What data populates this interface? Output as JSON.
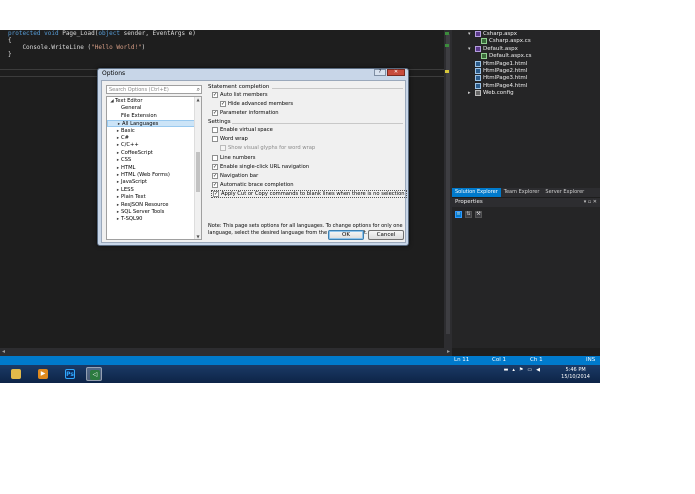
{
  "editor": {
    "lines": [
      {
        "kw1": "protected",
        "kw2": "void",
        "name": " Page_Load(",
        "kw3": "object",
        "rest": " sender, EventArgs e)"
      },
      {
        "text": "{"
      },
      {
        "pre": "    Console.WriteLine (",
        "str": "\"Hello World!\"",
        "post": ")"
      },
      {
        "text": "}"
      }
    ]
  },
  "solution_explorer": {
    "items": [
      {
        "label": "Csharp.aspx",
        "indent": 2,
        "expander": "▾",
        "icon": "aspx-file-icon"
      },
      {
        "label": "Csharp.aspx.cs",
        "indent": 3,
        "expander": "",
        "icon": "cs-file-icon"
      },
      {
        "label": "Default.aspx",
        "indent": 2,
        "expander": "▾",
        "icon": "aspx-file-icon"
      },
      {
        "label": "Default.aspx.cs",
        "indent": 3,
        "expander": "",
        "icon": "cs-file-icon"
      },
      {
        "label": "HtmlPage1.html",
        "indent": 2,
        "expander": "",
        "icon": "html-file-icon"
      },
      {
        "label": "HtmlPage2.html",
        "indent": 2,
        "expander": "",
        "icon": "html-file-icon"
      },
      {
        "label": "HtmlPage3.html",
        "indent": 2,
        "expander": "",
        "icon": "html-file-icon"
      },
      {
        "label": "HtmlPage4.html",
        "indent": 2,
        "expander": "",
        "icon": "html-file-icon"
      },
      {
        "label": "Web.config",
        "indent": 2,
        "expander": "▸",
        "icon": "config-file-icon"
      }
    ]
  },
  "panel_tabs": [
    "Solution Explorer",
    "Team Explorer",
    "Server Explorer"
  ],
  "properties": {
    "title": "Properties",
    "controls": "▾ ▫ ✕"
  },
  "statusbar": {
    "ln": "Ln 11",
    "col": "Col 1",
    "ch": "Ch 1",
    "ins": "INS"
  },
  "clock": {
    "time": "5:46 PM",
    "date": "15/10/2014"
  },
  "dialog": {
    "title": "Options",
    "search_placeholder": "Search Options (Ctrl+E)",
    "tree": [
      {
        "label": "Text Editor",
        "depth": 0,
        "arrow": "◢",
        "selected": false
      },
      {
        "label": "General",
        "depth": 1,
        "arrow": "",
        "selected": false
      },
      {
        "label": "File Extension",
        "depth": 1,
        "arrow": "",
        "selected": false
      },
      {
        "label": "All Languages",
        "depth": 1,
        "arrow": "▸",
        "selected": true
      },
      {
        "label": "Basic",
        "depth": 1,
        "arrow": "▸",
        "selected": false
      },
      {
        "label": "C#",
        "depth": 1,
        "arrow": "▸",
        "selected": false
      },
      {
        "label": "C/C++",
        "depth": 1,
        "arrow": "▸",
        "selected": false
      },
      {
        "label": "CoffeeScript",
        "depth": 1,
        "arrow": "▸",
        "selected": false
      },
      {
        "label": "CSS",
        "depth": 1,
        "arrow": "▸",
        "selected": false
      },
      {
        "label": "HTML",
        "depth": 1,
        "arrow": "▸",
        "selected": false
      },
      {
        "label": "HTML (Web Forms)",
        "depth": 1,
        "arrow": "▸",
        "selected": false
      },
      {
        "label": "JavaScript",
        "depth": 1,
        "arrow": "▸",
        "selected": false
      },
      {
        "label": "LESS",
        "depth": 1,
        "arrow": "▸",
        "selected": false
      },
      {
        "label": "Plain Text",
        "depth": 1,
        "arrow": "▸",
        "selected": false
      },
      {
        "label": "ResJSON Resource",
        "depth": 1,
        "arrow": "▸",
        "selected": false
      },
      {
        "label": "SQL Server Tools",
        "depth": 1,
        "arrow": "▸",
        "selected": false
      },
      {
        "label": "T-SQL90",
        "depth": 1,
        "arrow": "▸",
        "selected": false
      }
    ],
    "statement_completion": {
      "header": "Statement completion",
      "auto_list": "Auto list members",
      "hide_advanced": "Hide advanced members",
      "parameter_info": "Parameter information"
    },
    "settings": {
      "header": "Settings",
      "virtual_space": "Enable virtual space",
      "word_wrap": "Word wrap",
      "show_glyphs": "Show visual glyphs for word wrap",
      "line_numbers": "Line numbers",
      "single_click_url": "Enable single-click URL navigation",
      "navigation_bar": "Navigation bar",
      "brace_completion": "Automatic brace completion",
      "apply_cut_copy": "Apply Cut or Copy commands to blank lines when there is no selection"
    },
    "checked": {
      "auto_list": true,
      "hide_advanced": true,
      "parameter_info": true,
      "virtual_space": false,
      "word_wrap": false,
      "show_glyphs": false,
      "line_numbers": false,
      "single_click_url": true,
      "navigation_bar": true,
      "brace_completion": true,
      "apply_cut_copy": true
    },
    "note": "Note: This page sets options for all languages. To change options for only one language, select the desired language from the tree on the left.",
    "ok": "OK",
    "cancel": "Cancel"
  }
}
